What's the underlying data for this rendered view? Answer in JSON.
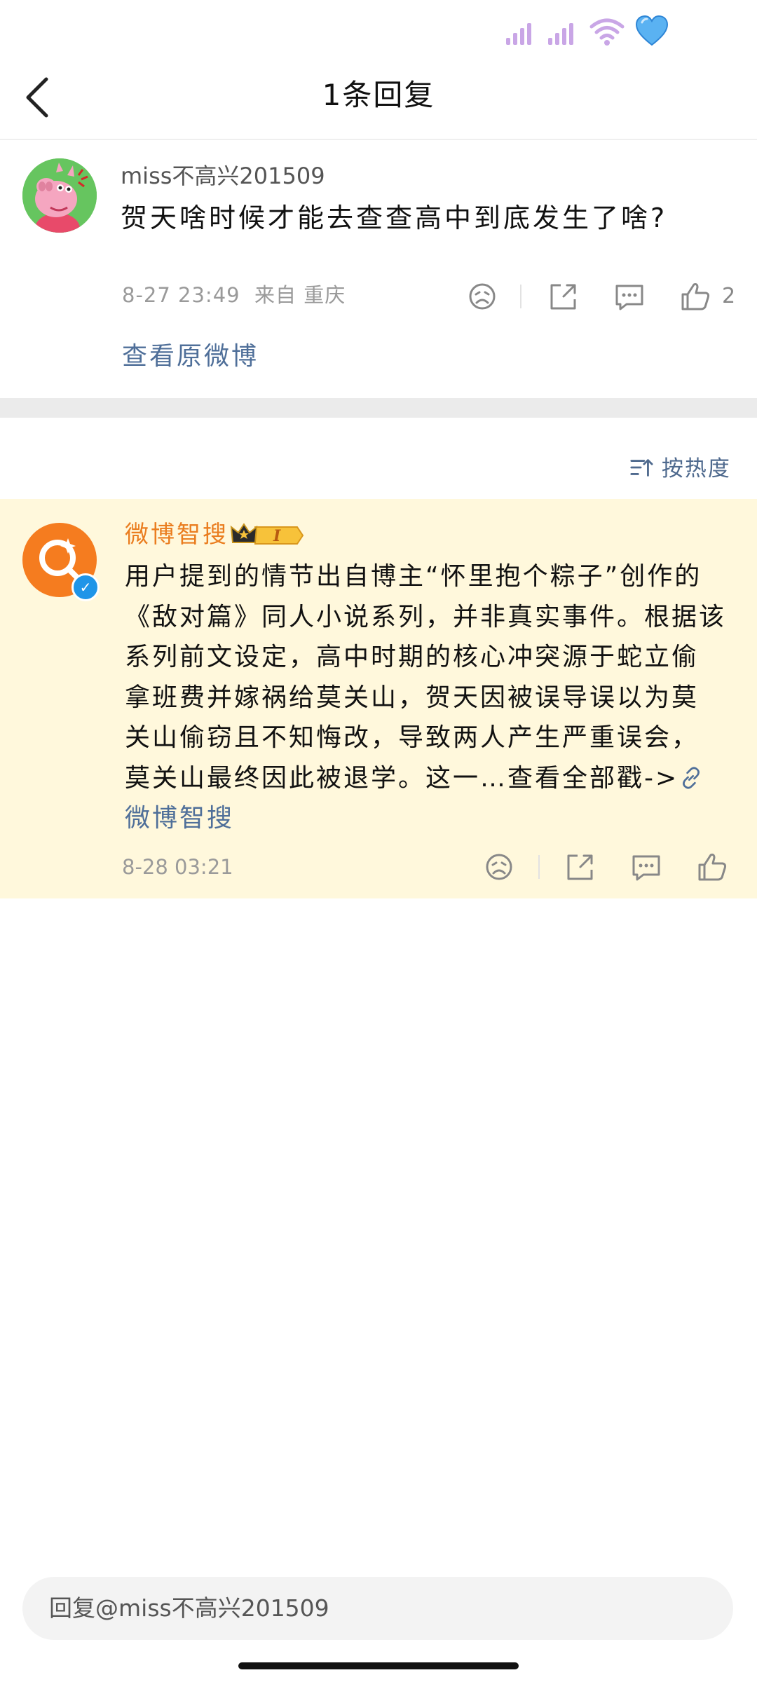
{
  "header": {
    "title": "1条回复"
  },
  "original_comment": {
    "username": "miss不高兴201509",
    "text": "贺天啥时候才能去查查高中到底发生了啥?",
    "timestamp": "8-27 23:49",
    "location": "来自 重庆",
    "like_count": "2",
    "view_original_label": "查看原微博"
  },
  "sort": {
    "label": "按热度"
  },
  "reply": {
    "username": "微博智搜",
    "badge_level": "I",
    "lines": [
      "用户提到的情节出自博主“怀里抱个粽子”创作的",
      "《敌对篇》同人小说系列，并非真实事件。根据该",
      "系列前文设定，高中时期的核心冲突源于蛇立偷",
      "拿班费并嫁祸给莫关山，贺天因被误导误以为莫",
      "关山偷窃且不知悔改，导致两人产生严重误会，",
      "莫关山最终因此被退学。这一…"
    ],
    "view_all_label": "查看全部戳->",
    "source_label": "微博智搜",
    "timestamp": "8-28 03:21"
  },
  "input": {
    "placeholder": "回复@miss不高兴201509"
  },
  "colors": {
    "link_blue": "#4f6f99",
    "reply_name_orange": "#ea7d1f",
    "reply_card_bg": "#fff8dc",
    "verified_blue": "#1f95e8"
  },
  "icons": [
    "signal-icon",
    "wifi-icon",
    "heart-icon",
    "back-arrow-icon",
    "dislike-icon",
    "share-icon",
    "comment-icon",
    "like-icon",
    "sort-icon",
    "link-icon",
    "verified-icon",
    "crown-badge-icon"
  ]
}
